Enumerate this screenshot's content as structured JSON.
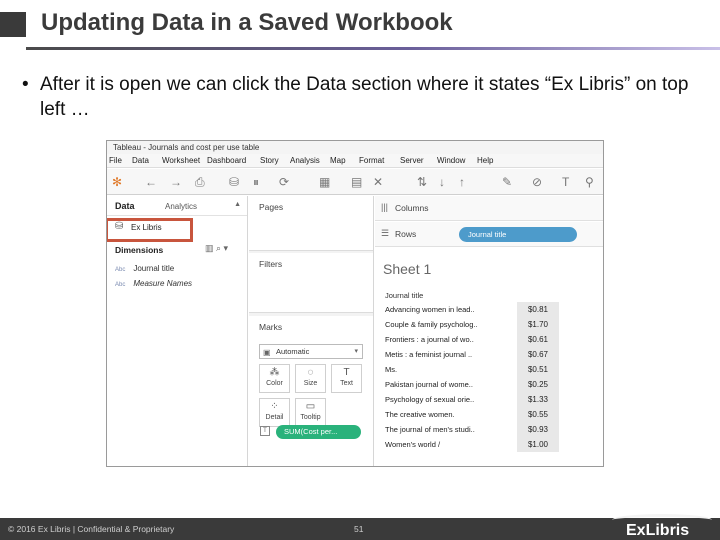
{
  "slide": {
    "title": "Updating Data in a Saved Workbook",
    "bullet_dot": "•",
    "bullet_text": "After it is open we can click the Data section where it states “Ex Libris” on top left …"
  },
  "tableau": {
    "window_title": "Tableau - Journals and cost per use table",
    "menu": [
      "File",
      "Data",
      "Worksheet",
      "Dashboard",
      "Story",
      "Analysis",
      "Map",
      "Format",
      "Server",
      "Window",
      "Help"
    ],
    "data_tab": "Data",
    "analytics_tab": "Analytics",
    "data_source": "Ex Libris",
    "dimensions_header": "Dimensions",
    "dimensions": [
      {
        "type": "Abc",
        "name": "Journal title"
      },
      {
        "type": "Abc",
        "name": "Measure Names"
      }
    ],
    "pages_label": "Pages",
    "filters_label": "Filters",
    "marks_label": "Marks",
    "marks_type": "Automatic",
    "mark_buttons": [
      "Color",
      "Size",
      "Text",
      "Detail",
      "Tooltip"
    ],
    "sum_pill": "SUM(Cost per...",
    "columns_label": "Columns",
    "rows_label": "Rows",
    "rows_pill": "Journal title",
    "sheet_title": "Sheet 1",
    "table_header": "Journal title",
    "table_rows": [
      {
        "title": "Advancing women in lead..",
        "value": "$0.81"
      },
      {
        "title": "Couple & family psycholog..",
        "value": "$1.70"
      },
      {
        "title": "Frontiers : a journal of wo..",
        "value": "$0.61"
      },
      {
        "title": "Metis : a feminist journal ..",
        "value": "$0.67"
      },
      {
        "title": "Ms.",
        "value": "$0.51"
      },
      {
        "title": "Pakistan journal of wome..",
        "value": "$0.25"
      },
      {
        "title": "Psychology of sexual orie..",
        "value": "$1.33"
      },
      {
        "title": "The creative women.",
        "value": "$0.55"
      },
      {
        "title": "The journal of men's studi..",
        "value": "$0.93"
      },
      {
        "title": "Women's world /",
        "value": "$1.00"
      }
    ]
  },
  "footer": {
    "copyright": "© 2016 Ex Libris | Confidential & Proprietary",
    "page_number": "51",
    "logo_text": "ExLibris"
  },
  "colors": {
    "highlight": "#c8553d",
    "rows_pill": "#4d9bcb",
    "sum_pill": "#2ab27b",
    "footer_bg": "#3a3a3a"
  }
}
